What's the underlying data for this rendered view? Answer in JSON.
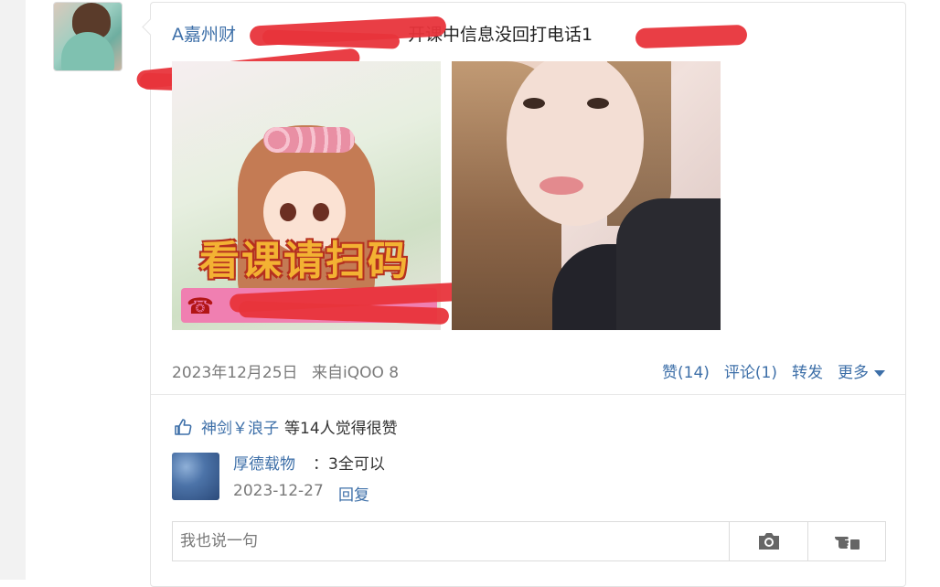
{
  "post": {
    "author": "A嘉州财",
    "text": "开课中信息没回打电话1",
    "image_caption": "看课请扫码",
    "phone_icon": "☎"
  },
  "meta": {
    "date": "2023年12月25日",
    "source": "来自iQOO 8",
    "like_label": "赞(14)",
    "comment_label": "评论(1)",
    "repost_label": "转发",
    "more_label": "更多"
  },
  "likes": {
    "liker": "神剑￥浪子",
    "count_text": "等14人",
    "suffix": "觉得很赞"
  },
  "comment": {
    "user": "厚德载物",
    "text": "：3全可以",
    "date": "2023-12-27",
    "reply_label": "回复"
  },
  "comment_box": {
    "placeholder": "我也说一句"
  },
  "icons": {
    "like": "thumbs-up-icon",
    "camera": "camera-icon",
    "send": "hand-pointer-icon"
  },
  "colors": {
    "link": "#3d6fa8",
    "redaction": "#e8343b"
  }
}
